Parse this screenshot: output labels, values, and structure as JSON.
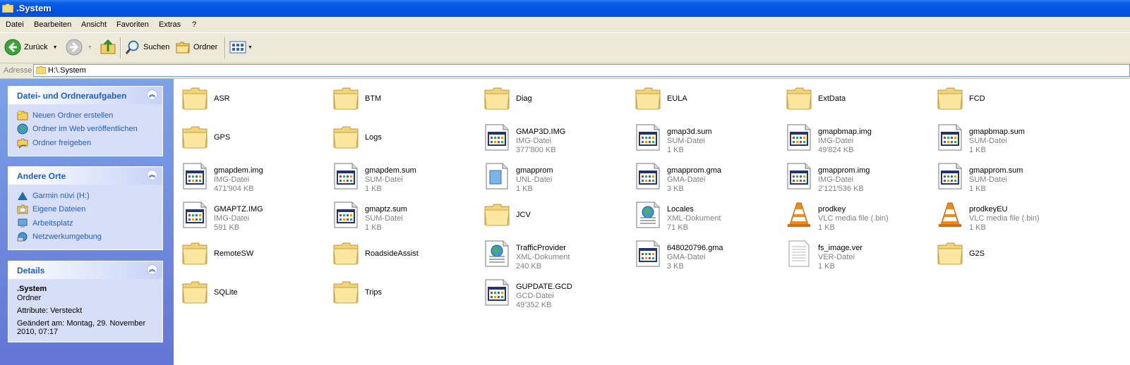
{
  "window": {
    "title": ".System"
  },
  "menu": [
    "Datei",
    "Bearbeiten",
    "Ansicht",
    "Favoriten",
    "Extras",
    "?"
  ],
  "toolbar": {
    "back": "Zurück",
    "search": "Suchen",
    "folders": "Ordner"
  },
  "address": {
    "label": "Adresse",
    "value": "H:\\.System"
  },
  "tasks": {
    "title": "Datei- und Ordneraufgaben",
    "items": [
      "Neuen Ordner erstellen",
      "Ordner im Web veröffentlichen",
      "Ordner freigeben"
    ]
  },
  "places": {
    "title": "Andere Orte",
    "items": [
      "Garmin nüvi (H:)",
      "Eigene Dateien",
      "Arbeitsplatz",
      "Netzwerkumgebung"
    ]
  },
  "details": {
    "title": "Details",
    "name": ".System",
    "type": "Ordner",
    "attr": "Attribute: Versteckt",
    "modified": "Geändert am: Montag, 29. November 2010, 07:17"
  },
  "files": [
    {
      "name": "ASR",
      "kind": "folder"
    },
    {
      "name": "BTM",
      "kind": "folder"
    },
    {
      "name": "Diag",
      "kind": "folder"
    },
    {
      "name": "EULA",
      "kind": "folder"
    },
    {
      "name": "ExtData",
      "kind": "folder"
    },
    {
      "name": "FCD",
      "kind": "folder"
    },
    {
      "name": "GPS",
      "kind": "folder"
    },
    {
      "name": "Logs",
      "kind": "folder"
    },
    {
      "name": "GMAP3D.IMG",
      "kind": "file",
      "icon": "app",
      "type": "IMG-Datei",
      "size": "377'800 KB"
    },
    {
      "name": "gmap3d.sum",
      "kind": "file",
      "icon": "app",
      "type": "SUM-Datei",
      "size": "1 KB"
    },
    {
      "name": "gmapbmap.img",
      "kind": "file",
      "icon": "app",
      "type": "IMG-Datei",
      "size": "49'824 KB"
    },
    {
      "name": "gmapbmap.sum",
      "kind": "file",
      "icon": "app",
      "type": "SUM-Datei",
      "size": "1 KB"
    },
    {
      "name": "gmapdem.img",
      "kind": "file",
      "icon": "app",
      "type": "IMG-Datei",
      "size": "471'904 KB"
    },
    {
      "name": "gmapdem.sum",
      "kind": "file",
      "icon": "app",
      "type": "SUM-Datei",
      "size": "1 KB"
    },
    {
      "name": "gmapprom",
      "kind": "file",
      "icon": "blank",
      "type": "UNL-Datei",
      "size": "1 KB"
    },
    {
      "name": "gmapprom.gma",
      "kind": "file",
      "icon": "app",
      "type": "GMA-Datei",
      "size": "3 KB"
    },
    {
      "name": "gmapprom.img",
      "kind": "file",
      "icon": "app",
      "type": "IMG-Datei",
      "size": "2'121'536 KB"
    },
    {
      "name": "gmapprom.sum",
      "kind": "file",
      "icon": "app",
      "type": "SUM-Datei",
      "size": "1 KB"
    },
    {
      "name": "GMAPTZ.IMG",
      "kind": "file",
      "icon": "app",
      "type": "IMG-Datei",
      "size": "591 KB"
    },
    {
      "name": "gmaptz.sum",
      "kind": "file",
      "icon": "app",
      "type": "SUM-Datei",
      "size": "1 KB"
    },
    {
      "name": "JCV",
      "kind": "folder"
    },
    {
      "name": "Locales",
      "kind": "file",
      "icon": "xml",
      "type": "XML-Dokument",
      "size": "71 KB"
    },
    {
      "name": "prodkey",
      "kind": "file",
      "icon": "vlc",
      "type": "VLC media file (.bin)",
      "size": "1 KB"
    },
    {
      "name": "prodkeyEU",
      "kind": "file",
      "icon": "vlc",
      "type": "VLC media file (.bin)",
      "size": "1 KB"
    },
    {
      "name": "RemoteSW",
      "kind": "folder"
    },
    {
      "name": "RoadsideAssist",
      "kind": "folder"
    },
    {
      "name": "TrafficProvider",
      "kind": "file",
      "icon": "xml",
      "type": "XML-Dokument",
      "size": "240 KB"
    },
    {
      "name": "648020796.gma",
      "kind": "file",
      "icon": "app",
      "type": "GMA-Datei",
      "size": "3 KB"
    },
    {
      "name": "fs_image.ver",
      "kind": "file",
      "icon": "text",
      "type": "VER-Datei",
      "size": "1 KB"
    },
    {
      "name": "G2S",
      "kind": "folder"
    },
    {
      "name": "SQLite",
      "kind": "folder"
    },
    {
      "name": "Trips",
      "kind": "folder"
    },
    {
      "name": "GUPDATE.GCD",
      "kind": "file",
      "icon": "app",
      "type": "GCD-Datei",
      "size": "49'352 KB"
    }
  ]
}
